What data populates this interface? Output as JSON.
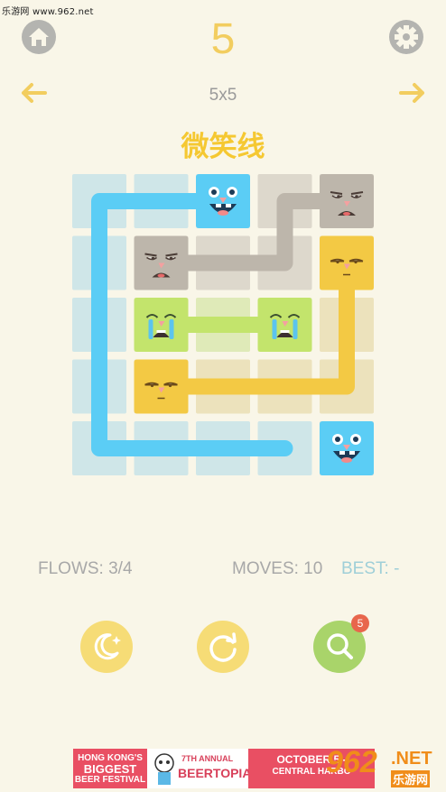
{
  "watermark_top": "乐游网 www.962.net",
  "header": {
    "level_number": "5",
    "grid_size": "5x5",
    "home_icon": "home-icon",
    "settings_icon": "gear-icon"
  },
  "nav": {
    "prev_icon": "arrow-left-icon",
    "next_icon": "arrow-right-icon"
  },
  "puzzle_title": "微笑线",
  "board": {
    "rows": 5,
    "cols": 5,
    "colors": {
      "blue": "#5bcdf5",
      "gray": "#bdb6ab",
      "green": "#c3e46c",
      "yellow": "#f3c944",
      "empty": "#d3dcd8",
      "filled_tint": "#e8e0c4"
    },
    "faces": [
      {
        "color": "blue",
        "row": 0,
        "col": 2,
        "mood": "grinning"
      },
      {
        "color": "blue",
        "row": 4,
        "col": 4,
        "mood": "grinning"
      },
      {
        "color": "gray",
        "row": 0,
        "col": 4,
        "mood": "annoyed"
      },
      {
        "color": "gray",
        "row": 1,
        "col": 1,
        "mood": "annoyed"
      },
      {
        "color": "green",
        "row": 2,
        "col": 1,
        "mood": "crying"
      },
      {
        "color": "green",
        "row": 2,
        "col": 3,
        "mood": "crying"
      },
      {
        "color": "yellow",
        "row": 1,
        "col": 4,
        "mood": "sleepy"
      },
      {
        "color": "yellow",
        "row": 3,
        "col": 1,
        "mood": "sleepy"
      }
    ],
    "flows": [
      {
        "color": "blue",
        "path": [
          [
            0,
            2
          ],
          [
            0,
            0
          ],
          [
            4,
            0
          ],
          [
            4,
            3
          ]
        ]
      },
      {
        "color": "gray",
        "path": [
          [
            0,
            4
          ],
          [
            0,
            3
          ],
          [
            1,
            3
          ],
          [
            1,
            1
          ]
        ]
      },
      {
        "color": "green",
        "path": [
          [
            2,
            1
          ],
          [
            2,
            3
          ]
        ]
      },
      {
        "color": "yellow",
        "path": [
          [
            1,
            4
          ],
          [
            3,
            4
          ],
          [
            3,
            1
          ]
        ]
      }
    ]
  },
  "stats": {
    "flows": "FLOWS: 3/4",
    "moves": "MOVES: 10",
    "best": "BEST: -"
  },
  "actions": {
    "night_icon": "moon-stars-icon",
    "restart_icon": "restart-icon",
    "hint_icon": "magnifier-icon",
    "hint_count": "5",
    "colors": {
      "night": "#f6dc76",
      "restart": "#f6dc76",
      "hint": "#a9d46a"
    }
  },
  "ad": {
    "seg1_line1": "HONG KONG'S",
    "seg1_line2": "BIGGEST",
    "seg1_line3": "BEER FESTIVAL",
    "seg2_line1": "7TH ANNUAL",
    "seg2_line2": "BEERTOPIA",
    "seg3_line1": "OCTOBER 5 -",
    "seg3_line2": "CENTRAL HARBO"
  },
  "watermark_logo": {
    "big": "962",
    "dotnet": ".NET",
    "cn": "乐游网"
  }
}
